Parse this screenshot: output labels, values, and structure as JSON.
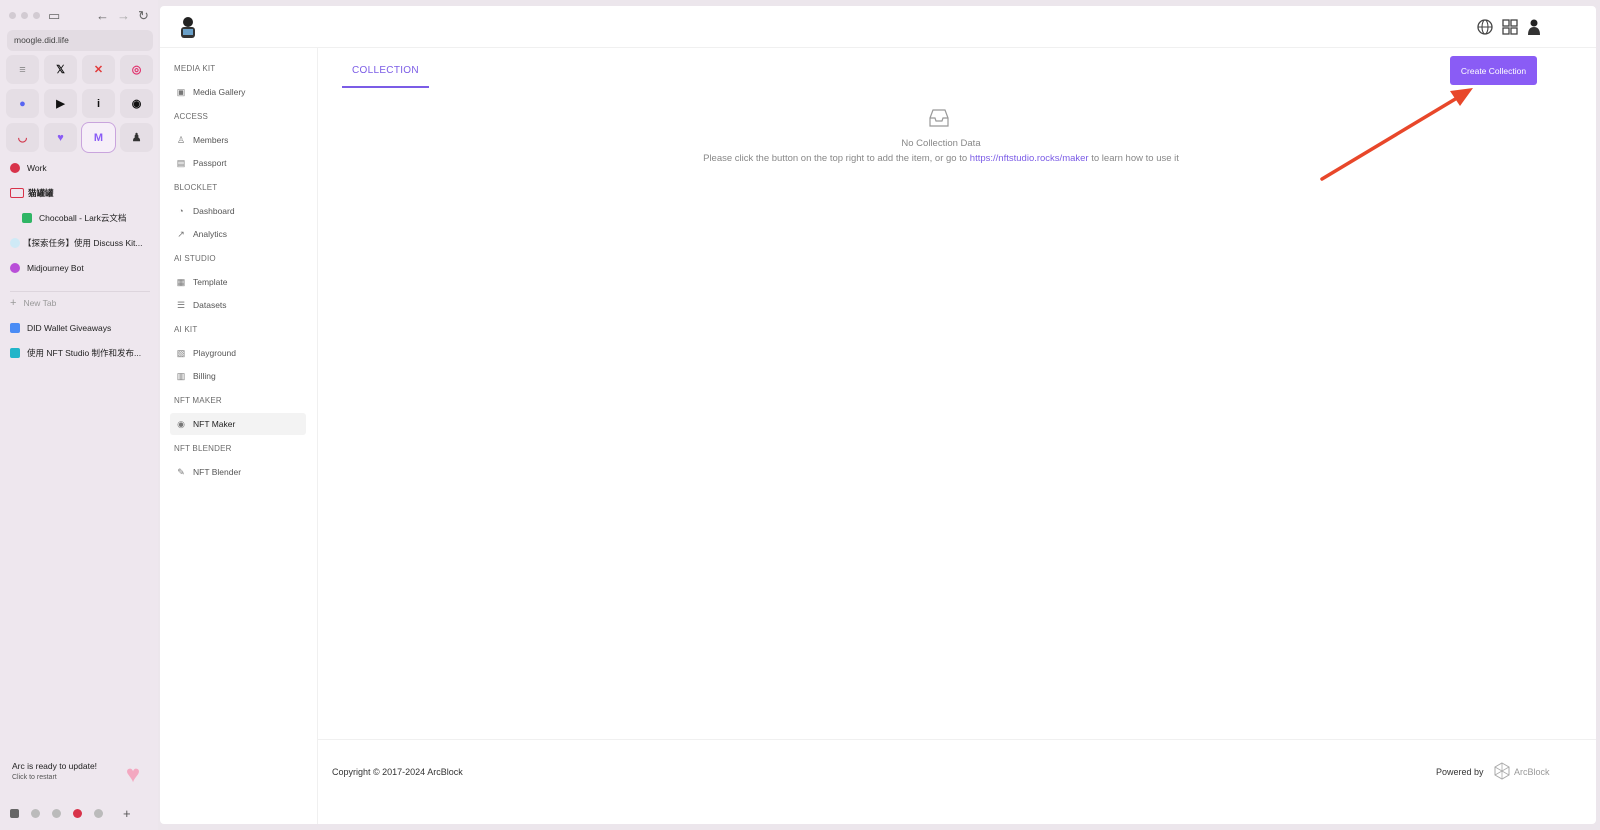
{
  "browser": {
    "url": "moogle.did.life",
    "favorites": [
      {
        "name": "sidebar-app-icon",
        "glyph": "≡",
        "color": "#888"
      },
      {
        "name": "x-twitter-icon",
        "glyph": "𝕏",
        "color": "#111"
      },
      {
        "name": "red-app-icon",
        "glyph": "✕",
        "color": "#e23b3b"
      },
      {
        "name": "instagram-icon",
        "glyph": "◎",
        "color": "#e1306c"
      },
      {
        "name": "chat-app-icon",
        "glyph": "●",
        "color": "#5865f2"
      },
      {
        "name": "play-icon",
        "glyph": "▶",
        "color": "#111"
      },
      {
        "name": "info-app-icon",
        "glyph": "i",
        "color": "#111"
      },
      {
        "name": "github-icon",
        "glyph": "◉",
        "color": "#111"
      },
      {
        "name": "red-bowl-icon",
        "glyph": "◡",
        "color": "#d23a4f"
      },
      {
        "name": "purple-app-icon",
        "glyph": "♥",
        "color": "#8a5cf5"
      },
      {
        "name": "mail-app-icon",
        "glyph": "M",
        "color": "#8a5cf5"
      },
      {
        "name": "avatar-app-icon",
        "glyph": "♟",
        "color": "#333"
      }
    ],
    "tabs": [
      {
        "label": "Work",
        "color": "#d8334a"
      },
      {
        "label": "猫罐罐",
        "color": "#d8334a"
      },
      {
        "label": "Chocoball - Lark云文档",
        "color": "#2fb565"
      },
      {
        "label": "【探索任务】使用 Discuss Kit...",
        "color": "#6ec6e8"
      },
      {
        "label": "Midjourney Bot",
        "color": "#b94fd8"
      },
      {
        "label": "New Tab",
        "color": "#999"
      },
      {
        "label": "DID Wallet Giveaways",
        "color": "#4a8cf5"
      },
      {
        "label": "使用 NFT Studio 制作和发布...",
        "color": "#22b5c9"
      }
    ],
    "update": {
      "title": "Arc is ready to update!",
      "subtitle": "Click to restart"
    }
  },
  "nav": {
    "sections": [
      {
        "title": "MEDIA KIT",
        "items": [
          {
            "label": "Media Gallery",
            "icon": "gallery-icon"
          }
        ]
      },
      {
        "title": "ACCESS",
        "items": [
          {
            "label": "Members",
            "icon": "user-icon"
          },
          {
            "label": "Passport",
            "icon": "passport-icon"
          }
        ]
      },
      {
        "title": "BLOCKLET",
        "items": [
          {
            "label": "Dashboard",
            "icon": "dashboard-icon"
          },
          {
            "label": "Analytics",
            "icon": "analytics-icon"
          }
        ]
      },
      {
        "title": "AI STUDIO",
        "items": [
          {
            "label": "Template",
            "icon": "template-icon"
          },
          {
            "label": "Datasets",
            "icon": "datasets-icon"
          }
        ]
      },
      {
        "title": "AI KIT",
        "items": [
          {
            "label": "Playground",
            "icon": "playground-icon"
          },
          {
            "label": "Billing",
            "icon": "billing-icon"
          }
        ]
      },
      {
        "title": "NFT MAKER",
        "items": [
          {
            "label": "NFT Maker",
            "icon": "nft-maker-icon",
            "active": true
          }
        ]
      },
      {
        "title": "NFT BLENDER",
        "items": [
          {
            "label": "NFT Blender",
            "icon": "pencil-icon"
          }
        ]
      }
    ]
  },
  "main": {
    "tab": "COLLECTION",
    "create_button": "Create Collection",
    "empty_title": "No Collection Data",
    "empty_desc_before": "Please click the button on the top right to add the item, or go to ",
    "empty_link": "https://nftstudio.rocks/maker",
    "empty_desc_after": " to learn how to use it"
  },
  "footer": {
    "copyright": "Copyright © 2017-2024  ArcBlock",
    "powered_by": "Powered by",
    "brand": "ArcBlock"
  },
  "colors": {
    "accent": "#8a5cf5",
    "annotation_arrow": "#e8472a"
  }
}
